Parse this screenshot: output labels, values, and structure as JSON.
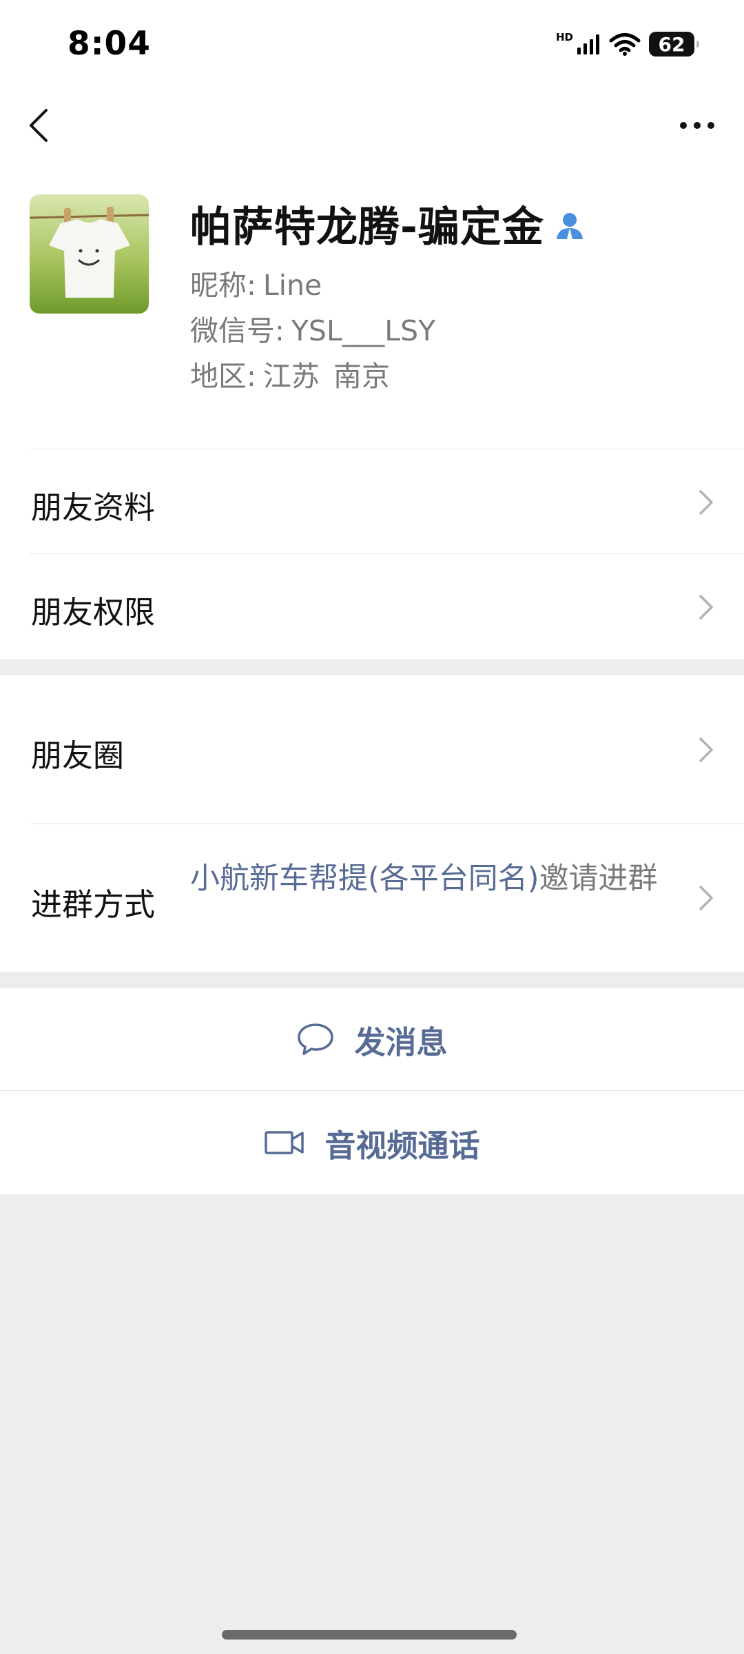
{
  "status_bar": {
    "time": "8:04",
    "network_label": "HD",
    "battery_level": "62",
    "icons": [
      "signal-icon",
      "wifi-icon",
      "battery-icon"
    ]
  },
  "nav": {
    "back_icon": "chevron-left-icon",
    "more_icon": "more-dots-icon"
  },
  "profile": {
    "display_name": "帕萨特龙腾-骗定金",
    "nickname_label": "昵称:",
    "nickname": "Line",
    "wechat_id_label": "微信号:",
    "wechat_id": "YSL___LSY",
    "region_label": "地区:",
    "region_province": "江苏",
    "region_city": "南京"
  },
  "menu": {
    "friend_info": "朋友资料",
    "friend_permissions": "朋友权限",
    "moments": "朋友圈",
    "join_group_label": "进群方式",
    "join_group_inviter": "小航新车帮提(各平台同名)",
    "join_group_suffix": "邀请进群"
  },
  "actions": {
    "send_message": "发消息",
    "video_call": "音视频通话"
  },
  "colors": {
    "link_blue": "#576b95",
    "background": "#ededed",
    "secondary_text": "#7a7a7a"
  }
}
